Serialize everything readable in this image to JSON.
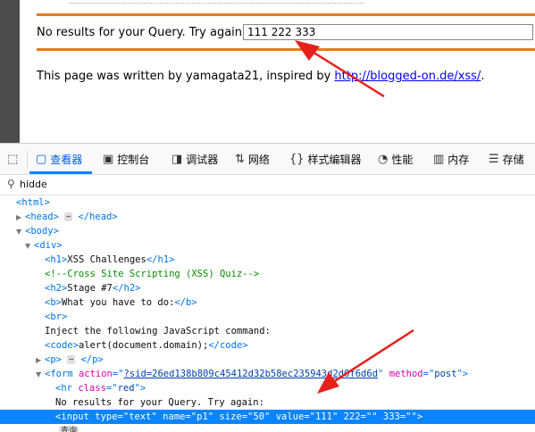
{
  "page": {
    "query_label": "No results for your Query. Try again:",
    "query_value": "111 222 333",
    "footer_prefix": "This page was written by yamagata21, inspired by ",
    "footer_link": "http://blogged-on.de/xss/",
    "footer_suffix": "."
  },
  "devtools": {
    "tabs": {
      "inspector": "查看器",
      "console": "控制台",
      "debugger": "调试器",
      "network": "网络",
      "style_editor": "样式编辑器",
      "performance": "性能",
      "memory": "内存",
      "storage": "存储"
    },
    "search_value": "hidde",
    "tree": {
      "html_open": "<html>",
      "head": "<head>",
      "head_close": "</head>",
      "body_open": "<body>",
      "div_open": "<div>",
      "h1_open": "<h1>",
      "h1_text": "XSS Challenges",
      "h1_close": "</h1>",
      "comment": "<!--Cross Site Scripting (XSS) Quiz-->",
      "h2_open": "<h2>",
      "h2_text": "Stage #7",
      "h2_close": "</h2>",
      "b_open": "<b>",
      "b_text": "What you have to do:",
      "b_close": "</b>",
      "br": "<br>",
      "inject_text": "Inject the following JavaScript command:",
      "code_open": "<code>",
      "code_text": "alert(document.domain);",
      "code_close": "</code>",
      "p_open": "<p>",
      "p_close": "</p>",
      "form_tag": "form",
      "form_action_attr": "action",
      "form_action_val": "?sid=26ed138b809c45412d32b58ec235943d2d0f6d6d",
      "form_method_attr": "method",
      "form_method_val": "post",
      "hr_tag": "hr",
      "hr_class_attr": "class",
      "hr_class_val": "red",
      "no_results_text": "No results for your Query. Try again:",
      "input_tag": "input",
      "input_type_attr": "type",
      "input_type_val": "text",
      "input_name_attr": "name",
      "input_name_val": "p1",
      "input_size_attr": "size",
      "input_size_val": "50",
      "input_value_attr": "value",
      "input_value_val": "111",
      "input_extra_attr1": "222",
      "input_extra_val1": "",
      "input_extra_attr2": "333",
      "input_extra_val2": "",
      "next_row_partial": "查询"
    }
  },
  "colors": {
    "accent": "#0a84ff",
    "orange_rule": "#f07818",
    "arrow": "#e8201a"
  }
}
